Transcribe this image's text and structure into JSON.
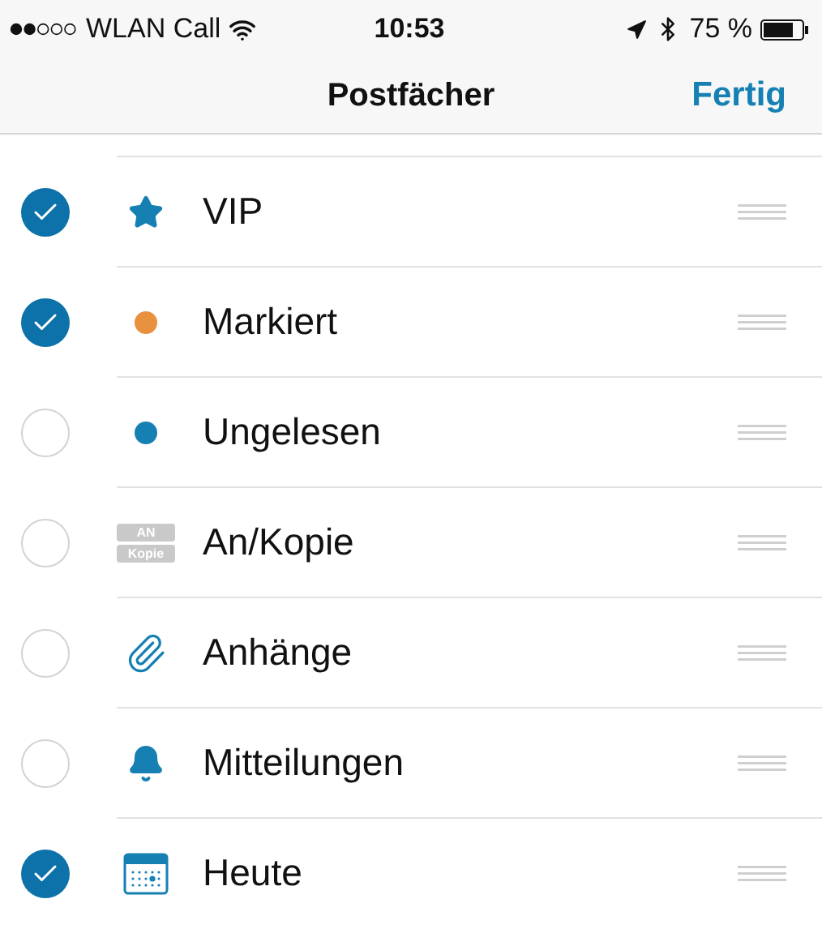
{
  "status_bar": {
    "carrier": "WLAN Call",
    "time": "10:53",
    "battery": "75 %"
  },
  "nav": {
    "title": "Postfächer",
    "action": "Fertig"
  },
  "mailboxes": [
    {
      "label": "VIP",
      "kind": "star",
      "checked": true
    },
    {
      "label": "Markiert",
      "kind": "dot",
      "color": "#e8913f",
      "checked": true
    },
    {
      "label": "Ungelesen",
      "kind": "dot",
      "color": "#1680b3",
      "checked": false
    },
    {
      "label": "An/Kopie",
      "kind": "badge",
      "badge_lines": [
        "AN",
        "Kopie"
      ],
      "checked": false
    },
    {
      "label": "Anhänge",
      "kind": "paperclip",
      "checked": false
    },
    {
      "label": "Mitteilungen",
      "kind": "bell",
      "checked": false
    },
    {
      "label": "Heute",
      "kind": "calendar",
      "checked": true
    }
  ]
}
